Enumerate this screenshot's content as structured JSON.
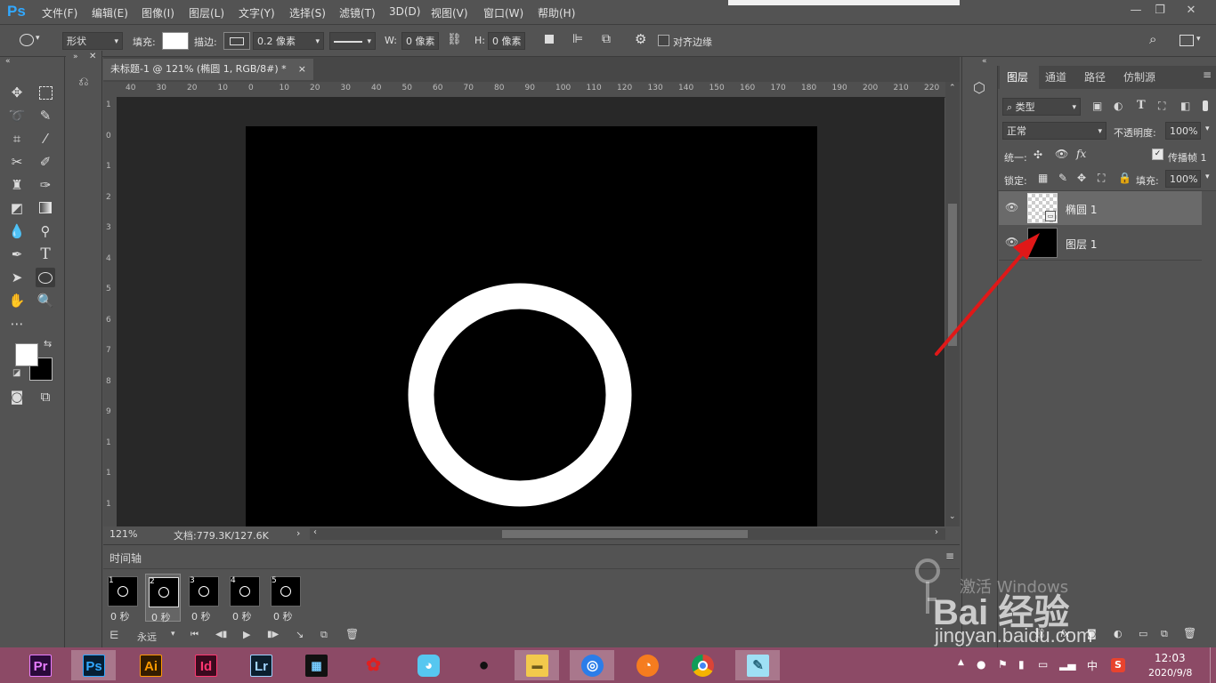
{
  "app": {
    "logo": "Ps",
    "menus": [
      "文件(F)",
      "编辑(E)",
      "图像(I)",
      "图层(L)",
      "文字(Y)",
      "选择(S)",
      "滤镜(T)",
      "3D(D)",
      "视图(V)",
      "窗口(W)",
      "帮助(H)"
    ],
    "window_controls": [
      "—",
      "❐",
      "✕"
    ]
  },
  "options": {
    "mode": "形状",
    "fill_label": "填充:",
    "stroke_label": "描边:",
    "stroke_width": "0.2 像素",
    "w_label": "W:",
    "w_value": "0 像素",
    "h_label": "H:",
    "h_value": "0 像素",
    "align_edges": "对齐边缘"
  },
  "document": {
    "tab_title": "未标题-1 @ 121% (椭圆 1, RGB/8#) *",
    "ruler_h": [
      "40",
      "30",
      "20",
      "10",
      "0",
      "10",
      "20",
      "30",
      "40",
      "50",
      "60",
      "70",
      "80",
      "90",
      "100",
      "110",
      "120",
      "130",
      "140",
      "150",
      "160",
      "170",
      "180",
      "190",
      "200",
      "210",
      "220"
    ],
    "ruler_v": [
      "1",
      "0",
      "1",
      "2",
      "3",
      "4",
      "5",
      "6",
      "7",
      "8",
      "9",
      "1",
      "1",
      "1"
    ],
    "zoom": "121%",
    "doc_size": "文档:779.3K/127.6K"
  },
  "timeline": {
    "title": "时间轴",
    "loop": "永远",
    "frames": [
      {
        "num": "1",
        "duration": "0 秒"
      },
      {
        "num": "2",
        "duration": "0 秒"
      },
      {
        "num": "3",
        "duration": "0 秒"
      },
      {
        "num": "4",
        "duration": "0 秒"
      },
      {
        "num": "5",
        "duration": "0 秒"
      }
    ]
  },
  "layers_panel": {
    "tabs": [
      "图层",
      "通道",
      "路径",
      "仿制源"
    ],
    "filter_kind": "类型",
    "blend_mode": "正常",
    "opacity_label": "不透明度:",
    "opacity": "100%",
    "unify_label": "统一:",
    "propagate": "传播帧 1",
    "lock_label": "锁定:",
    "fill_label": "填充:",
    "fill": "100%",
    "layers": [
      {
        "name": "椭圆 1"
      },
      {
        "name": "图层 1"
      }
    ]
  },
  "watermark": {
    "brand": "Bai 经验",
    "url": "jingyan.baidu.com",
    "activation": "激活 Windows"
  },
  "taskbar": {
    "apps": [
      "Pr",
      "Ps",
      "Ai",
      "Id",
      "Lr"
    ],
    "time": "12:03",
    "date": "2020/9/8",
    "ime": "中"
  },
  "colors": {
    "ps_blue": "#31a8ff",
    "taskbar": "#8c4a66",
    "arrow": "#e01818"
  }
}
